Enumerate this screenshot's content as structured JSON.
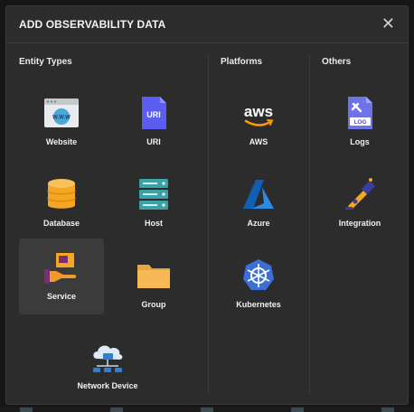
{
  "dialog": {
    "title": "ADD OBSERVABILITY DATA",
    "close_glyph": "✕"
  },
  "sections": {
    "entity_types": "Entity Types",
    "platforms": "Platforms",
    "others": "Others"
  },
  "tiles": {
    "website": {
      "label": "Website",
      "icon": "website-icon",
      "badge": "W.W.W"
    },
    "uri": {
      "label": "URI",
      "icon": "uri-icon",
      "badge": "URI"
    },
    "database": {
      "label": "Database",
      "icon": "database-icon"
    },
    "host": {
      "label": "Host",
      "icon": "host-icon"
    },
    "service": {
      "label": "Service",
      "icon": "service-icon",
      "selected": true
    },
    "group": {
      "label": "Group",
      "icon": "folder-icon"
    },
    "network_device": {
      "label": "Network Device",
      "icon": "network-device-icon"
    },
    "aws": {
      "label": "AWS",
      "icon": "aws-icon",
      "logo_text": "aws"
    },
    "azure": {
      "label": "Azure",
      "icon": "azure-icon"
    },
    "kubernetes": {
      "label": "Kubernetes",
      "icon": "kubernetes-icon"
    },
    "logs": {
      "label": "Logs",
      "icon": "logs-icon",
      "badge": "LOG"
    },
    "integration": {
      "label": "Integration",
      "icon": "integration-icon"
    }
  },
  "colors": {
    "uri": "#5b5cf0",
    "database": "#f5a623",
    "host": "#3aa3a8",
    "folder": "#f7b955",
    "aws_orange": "#ff9900",
    "azure": "#1f7ad0",
    "kubernetes": "#3b6fd6",
    "logs": "#6e73e8"
  }
}
